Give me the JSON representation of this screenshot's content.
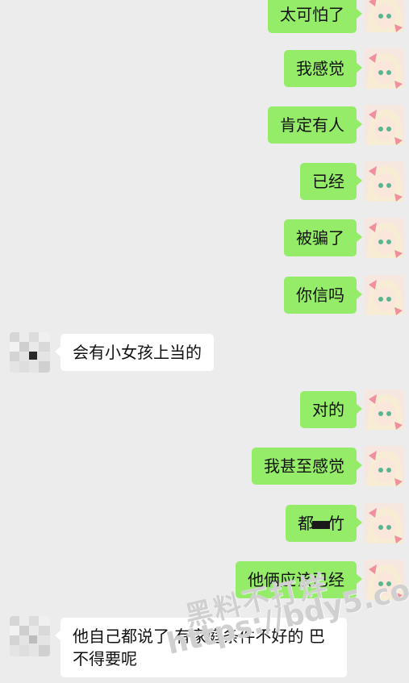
{
  "messages": [
    {
      "side": "me",
      "text": "太可怕了"
    },
    {
      "side": "me",
      "text": "我感觉"
    },
    {
      "side": "me",
      "text": "肯定有人"
    },
    {
      "side": "me",
      "text": "已经"
    },
    {
      "side": "me",
      "text": "被骗了"
    },
    {
      "side": "me",
      "text": "你信吗"
    },
    {
      "side": "other",
      "text": "会有小女孩上当的"
    },
    {
      "side": "me",
      "text": "对的"
    },
    {
      "side": "me",
      "text": "我甚至感觉"
    },
    {
      "side": "me",
      "text_before": "都",
      "text_after": "竹"
    },
    {
      "side": "me",
      "text": "他俩应该已经"
    },
    {
      "side": "other",
      "text": "他自己都说了 有家庭条件不好的 巴不得要呢"
    }
  ],
  "watermark": {
    "line1": "黑料不打烊",
    "line2": "https://bdy5.co"
  },
  "avatar_me": {
    "hair": "#f7ecd4",
    "bow": "#f08f9e",
    "eye": "#58b58e",
    "bg": "#f6e7e1"
  },
  "avatar_other": {
    "style": "pixelated"
  }
}
